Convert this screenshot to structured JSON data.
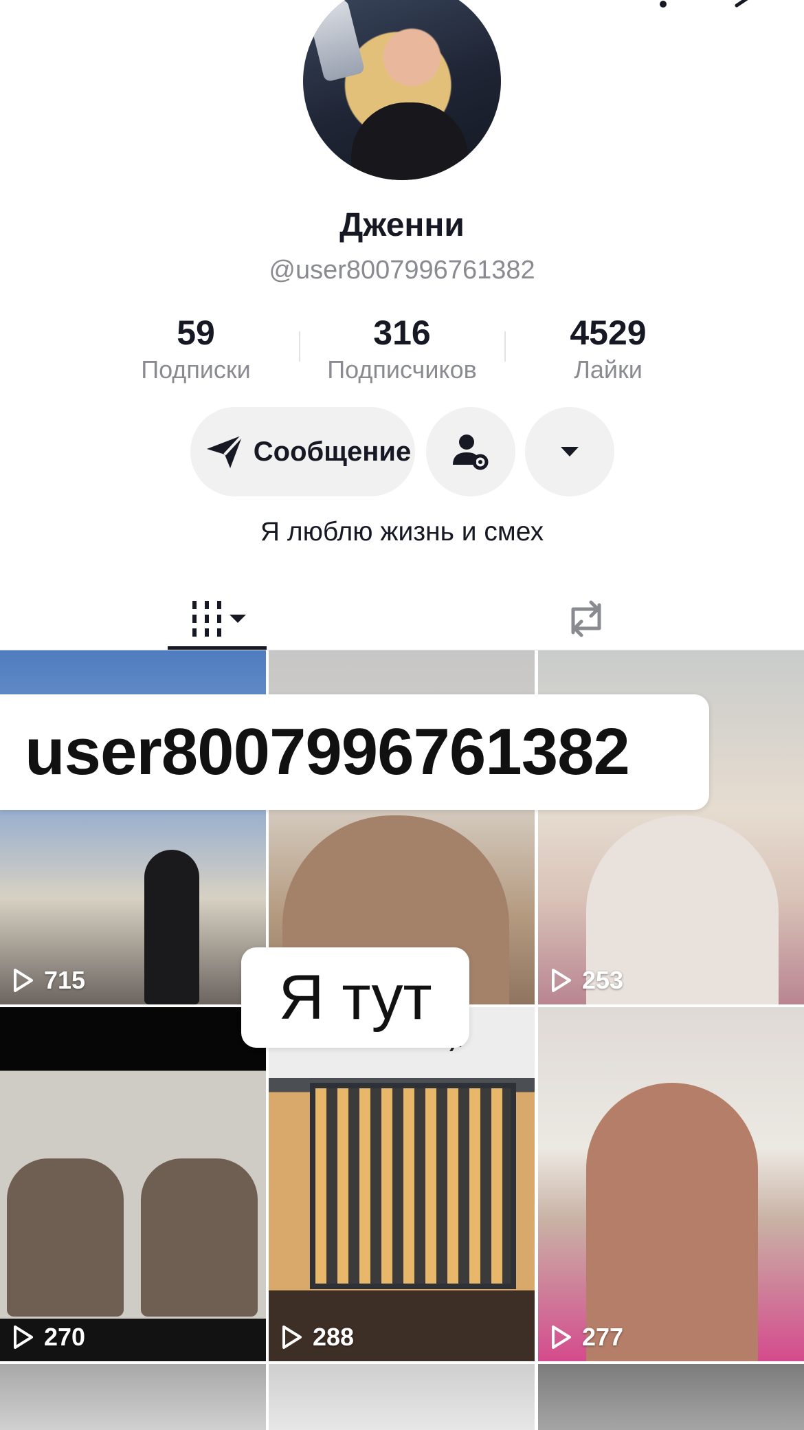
{
  "profile": {
    "display_name": "Дженни",
    "username": "@user8007996761382",
    "bio": "Я люблю жизнь и смех"
  },
  "stats": {
    "following": {
      "value": "59",
      "label": "Подписки"
    },
    "followers": {
      "value": "316",
      "label": "Подписчиков"
    },
    "likes": {
      "value": "4529",
      "label": "Лайки"
    }
  },
  "actions": {
    "message_label": "Сообщение",
    "friends_icon": "user-gear-icon",
    "more_icon": "caret-down-icon"
  },
  "tabs": [
    {
      "name": "videos",
      "icon": "grid-icon",
      "active": true
    },
    {
      "name": "reposts",
      "icon": "repost-icon",
      "active": false
    }
  ],
  "videos": [
    {
      "views": "715"
    },
    {
      "views": ""
    },
    {
      "views": "253"
    },
    {
      "views": "270"
    },
    {
      "views": "288",
      "caption": "собылось )!"
    },
    {
      "views": "277"
    }
  ],
  "overlays": {
    "username_sticker": "user8007996761382",
    "here_sticker": "Я тут"
  },
  "colors": {
    "text": "#161823",
    "secondary_text": "#8a8b91",
    "button_bg": "#f1f1f2"
  }
}
